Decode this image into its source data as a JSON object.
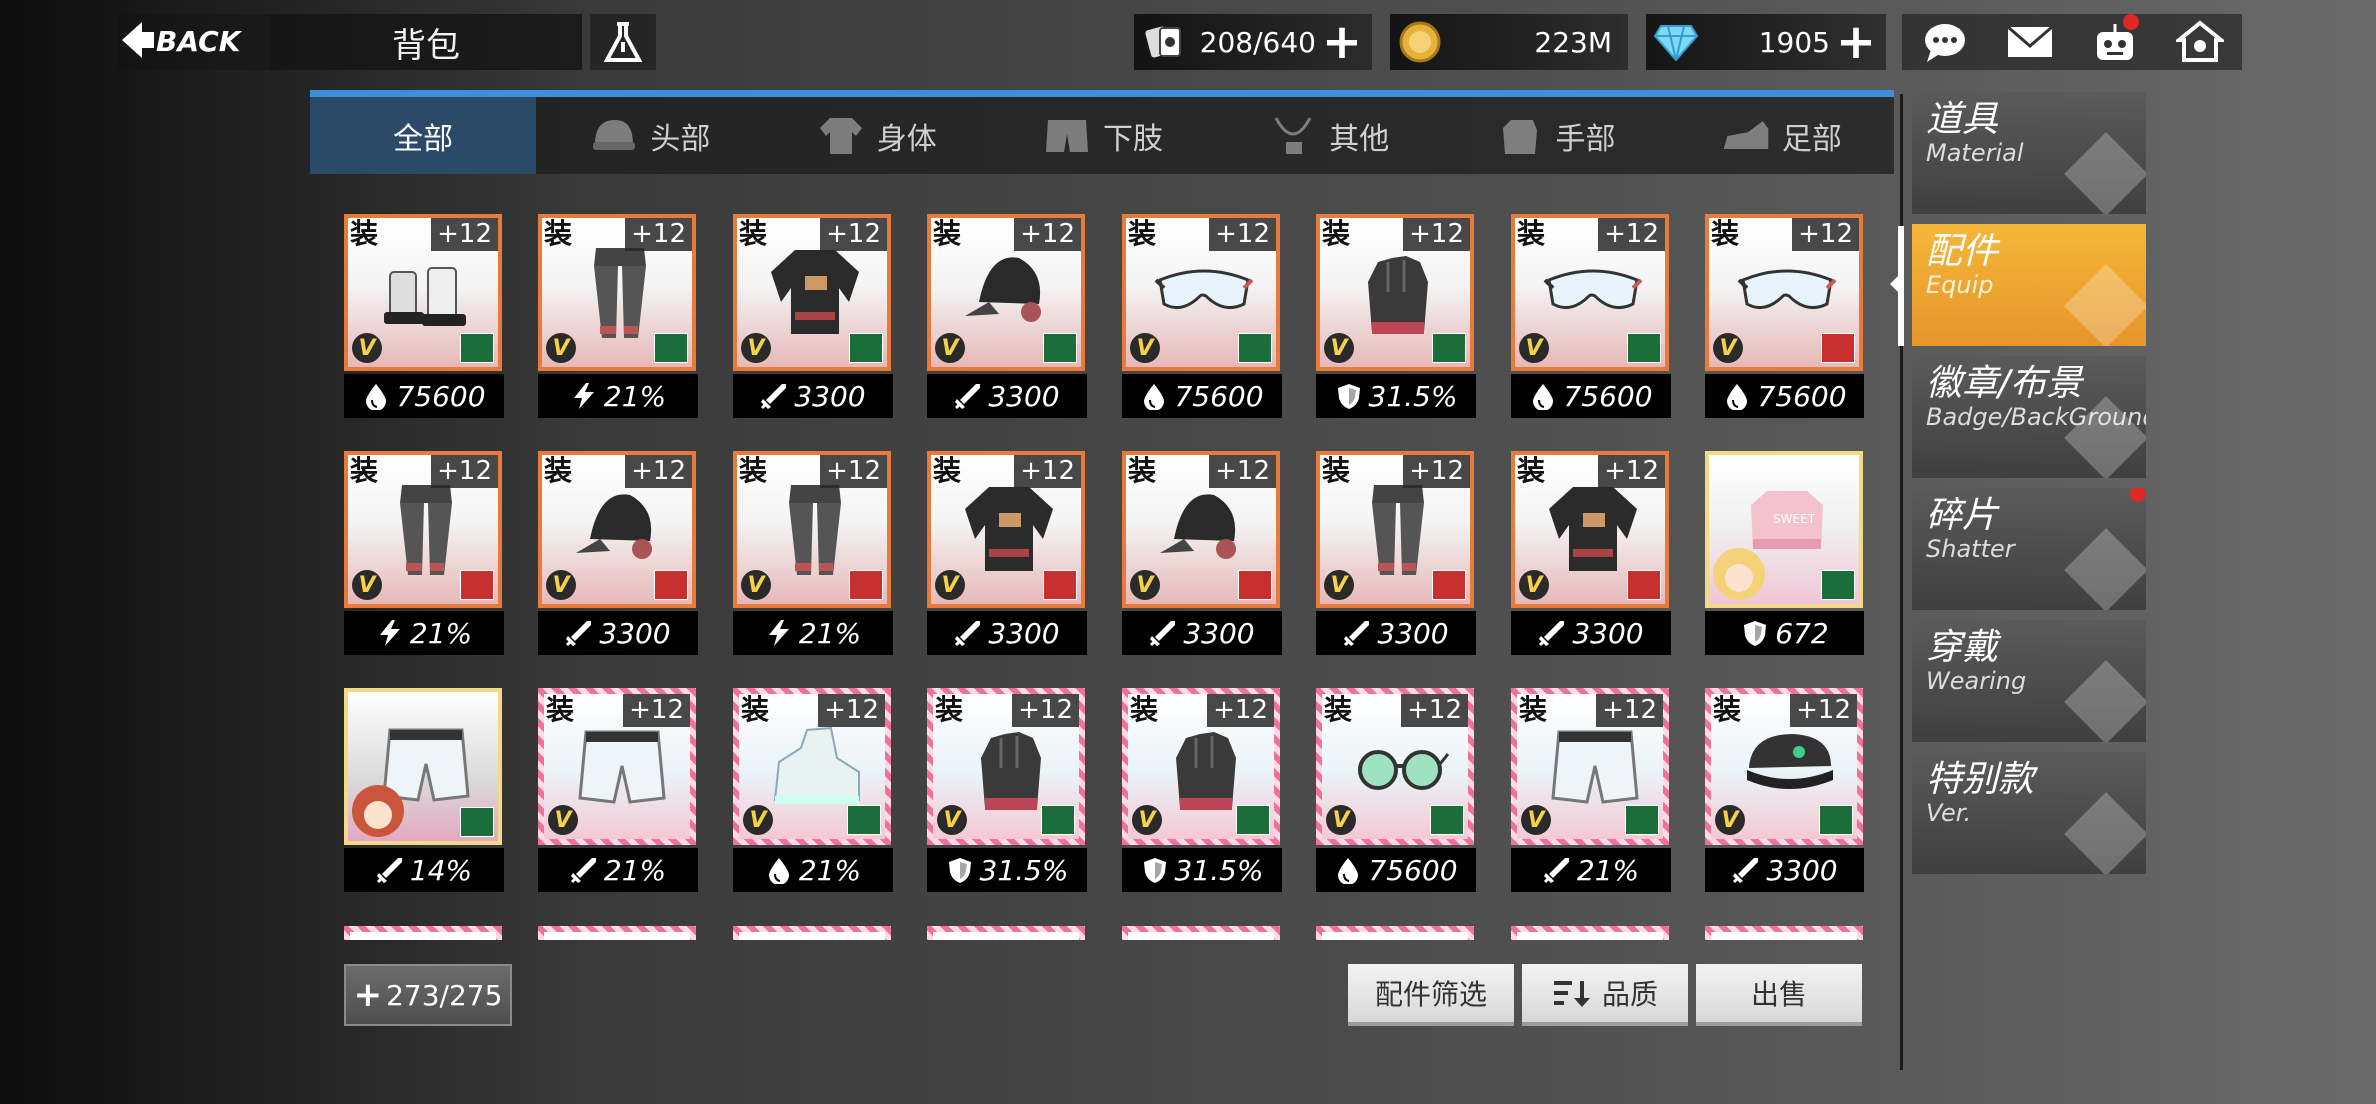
{
  "header": {
    "back_label": "BACK",
    "title": "背包",
    "stamina": "208/640",
    "gold": "223M",
    "gems": "1905"
  },
  "tabs": [
    {
      "label": "全部",
      "icon": "",
      "active": true
    },
    {
      "label": "头部",
      "icon": "helmet-icon",
      "active": false
    },
    {
      "label": "身体",
      "icon": "shirt-icon",
      "active": false
    },
    {
      "label": "下肢",
      "icon": "shorts-icon",
      "active": false
    },
    {
      "label": "其他",
      "icon": "necklace-icon",
      "active": false
    },
    {
      "label": "手部",
      "icon": "glove-icon",
      "active": false
    },
    {
      "label": "足部",
      "icon": "shoe-icon",
      "active": false
    }
  ],
  "items": [
    {
      "tag": "装",
      "level": "+12",
      "stat": "75600",
      "stat_icon": "drop-icon",
      "frame": "orange",
      "art": "boots",
      "brand": "green"
    },
    {
      "tag": "装",
      "level": "+12",
      "stat": "21%",
      "stat_icon": "bolt-icon",
      "frame": "orange",
      "art": "pants",
      "brand": "green"
    },
    {
      "tag": "装",
      "level": "+12",
      "stat": "3300",
      "stat_icon": "sword-icon",
      "frame": "orange",
      "art": "jacket",
      "brand": "green"
    },
    {
      "tag": "装",
      "level": "+12",
      "stat": "3300",
      "stat_icon": "sword-icon",
      "frame": "orange",
      "art": "hat",
      "brand": "green"
    },
    {
      "tag": "装",
      "level": "+12",
      "stat": "75600",
      "stat_icon": "drop-icon",
      "frame": "orange",
      "art": "goggles",
      "brand": "green"
    },
    {
      "tag": "装",
      "level": "+12",
      "stat": "31.5%",
      "stat_icon": "shield-icon",
      "frame": "orange",
      "art": "glove",
      "brand": "green"
    },
    {
      "tag": "装",
      "level": "+12",
      "stat": "75600",
      "stat_icon": "drop-icon",
      "frame": "orange",
      "art": "goggles",
      "brand": "green"
    },
    {
      "tag": "装",
      "level": "+12",
      "stat": "75600",
      "stat_icon": "drop-icon",
      "frame": "orange",
      "art": "goggles",
      "brand": "red"
    },
    {
      "tag": "装",
      "level": "+12",
      "stat": "21%",
      "stat_icon": "bolt-icon",
      "frame": "orange",
      "art": "pants",
      "brand": "red"
    },
    {
      "tag": "装",
      "level": "+12",
      "stat": "3300",
      "stat_icon": "sword-icon",
      "frame": "orange",
      "art": "hat",
      "brand": "red"
    },
    {
      "tag": "装",
      "level": "+12",
      "stat": "21%",
      "stat_icon": "bolt-icon",
      "frame": "orange",
      "art": "pants",
      "brand": "red"
    },
    {
      "tag": "装",
      "level": "+12",
      "stat": "3300",
      "stat_icon": "sword-icon",
      "frame": "orange",
      "art": "jacket",
      "brand": "red"
    },
    {
      "tag": "装",
      "level": "+12",
      "stat": "3300",
      "stat_icon": "sword-icon",
      "frame": "orange",
      "art": "hat",
      "brand": "red"
    },
    {
      "tag": "装",
      "level": "+12",
      "stat": "3300",
      "stat_icon": "sword-icon",
      "frame": "orange",
      "art": "pants",
      "brand": "red"
    },
    {
      "tag": "装",
      "level": "+12",
      "stat": "3300",
      "stat_icon": "sword-icon",
      "frame": "orange",
      "art": "jacket",
      "brand": "red"
    },
    {
      "tag": "",
      "level": "",
      "stat": "672",
      "stat_icon": "shield-icon",
      "frame": "gold",
      "art": "pinkglove",
      "brand": "green"
    },
    {
      "tag": "",
      "level": "",
      "stat": "14%",
      "stat_icon": "sword-icon",
      "frame": "gold-grey",
      "art": "shorts",
      "brand": "green"
    },
    {
      "tag": "装",
      "level": "+12",
      "stat": "21%",
      "stat_icon": "sword-icon",
      "frame": "pink",
      "art": "shorts",
      "brand": "orange"
    },
    {
      "tag": "装",
      "level": "+12",
      "stat": "21%",
      "stat_icon": "drop-icon",
      "frame": "pink",
      "art": "sneaker",
      "brand": "green"
    },
    {
      "tag": "装",
      "level": "+12",
      "stat": "31.5%",
      "stat_icon": "shield-icon",
      "frame": "pink",
      "art": "glove",
      "brand": "green"
    },
    {
      "tag": "装",
      "level": "+12",
      "stat": "31.5%",
      "stat_icon": "shield-icon",
      "frame": "pink",
      "art": "glove",
      "brand": "green"
    },
    {
      "tag": "装",
      "level": "+12",
      "stat": "75600",
      "stat_icon": "drop-icon",
      "frame": "pink",
      "art": "glasses",
      "brand": "green"
    },
    {
      "tag": "装",
      "level": "+12",
      "stat": "21%",
      "stat_icon": "sword-icon",
      "frame": "pink",
      "art": "shorts",
      "brand": "green"
    },
    {
      "tag": "装",
      "level": "+12",
      "stat": "3300",
      "stat_icon": "sword-icon",
      "frame": "pink",
      "art": "cap",
      "brand": "green"
    }
  ],
  "footer": {
    "capacity": "273/275",
    "filter_label": "配件筛选",
    "sort_label": "品质",
    "sell_label": "出售"
  },
  "side": [
    {
      "title": "道具",
      "sub": "Material",
      "active": false
    },
    {
      "title": "配件",
      "sub": "Equip",
      "active": true
    },
    {
      "title": "徽章/布景",
      "sub": "Badge/BackGround",
      "active": false
    },
    {
      "title": "碎片",
      "sub": "Shatter",
      "active": false,
      "dot": true
    },
    {
      "title": "穿戴",
      "sub": "Wearing",
      "active": false
    },
    {
      "title": "特别款",
      "sub": "Ver.",
      "active": false
    }
  ],
  "colors": {
    "tab_accent": "#3d8fd9",
    "active_tab": "#2b4a68",
    "side_active": "#f0a832",
    "frame_orange": "#e87b3c",
    "frame_pink": "#f26f99",
    "frame_gold": "#f3d98a"
  }
}
